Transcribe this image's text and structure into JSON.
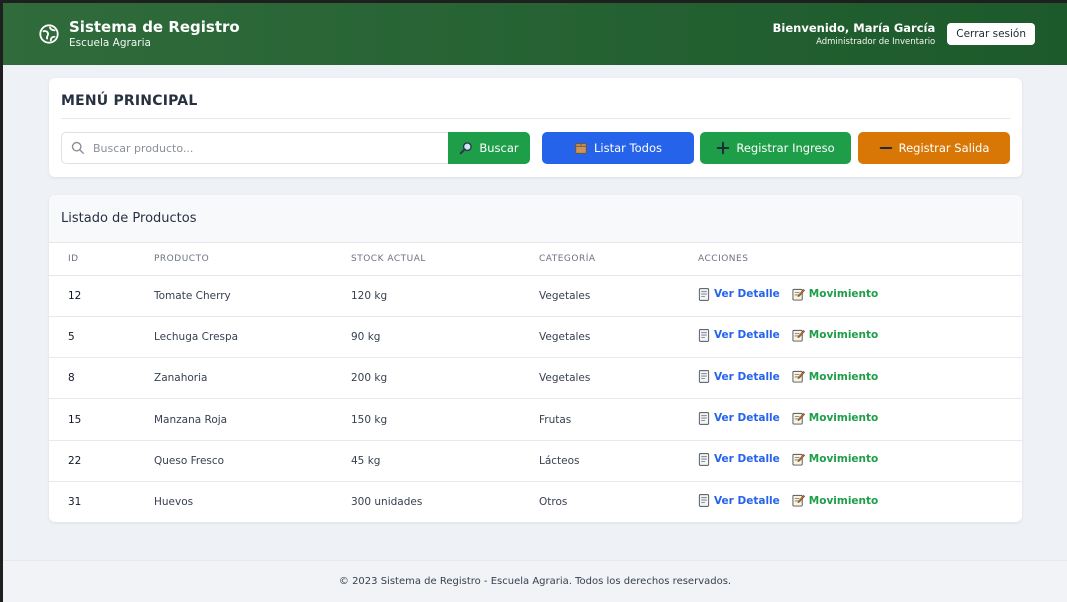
{
  "header": {
    "title": "Sistema de Registro",
    "subtitle": "Escuela Agraria",
    "user_greeting": "Bienvenido, María García",
    "user_role": "Administrador de Inventario",
    "logout_label": "Cerrar sesión",
    "logo_icon": "leaf-logo-icon"
  },
  "menu": {
    "title": "MENÚ PRINCIPAL",
    "search_placeholder": "Buscar producto...",
    "search_value": "",
    "search_button": "Buscar",
    "list_button": "Listar Todos",
    "entry_button": "Registrar Ingreso",
    "exit_button": "Registrar Salida"
  },
  "products": {
    "title": "Listado de Productos",
    "columns": [
      "ID",
      "PRODUCTO",
      "STOCK ACTUAL",
      "CATEGORÍA",
      "ACCIONES"
    ],
    "view_label": "Ver Detalle",
    "move_label": "Movimiento",
    "rows": [
      {
        "id": "12",
        "name": "Tomate Cherry",
        "stock": "120 kg",
        "category": "Vegetales"
      },
      {
        "id": "5",
        "name": "Lechuga Crespa",
        "stock": "90 kg",
        "category": "Vegetales"
      },
      {
        "id": "8",
        "name": "Zanahoria",
        "stock": "200 kg",
        "category": "Vegetales"
      },
      {
        "id": "15",
        "name": "Manzana Roja",
        "stock": "150 kg",
        "category": "Frutas"
      },
      {
        "id": "22",
        "name": "Queso Fresco",
        "stock": "45 kg",
        "category": "Lácteos"
      },
      {
        "id": "31",
        "name": "Huevos",
        "stock": "300 unidades",
        "category": "Otros"
      }
    ]
  },
  "footer": {
    "text": "© 2023 Sistema de Registro - Escuela Agraria. Todos los derechos reservados."
  },
  "colors": {
    "header_green": "#2f6b3b",
    "green": "#1e9e49",
    "blue": "#2563eb",
    "orange": "#d97706"
  }
}
